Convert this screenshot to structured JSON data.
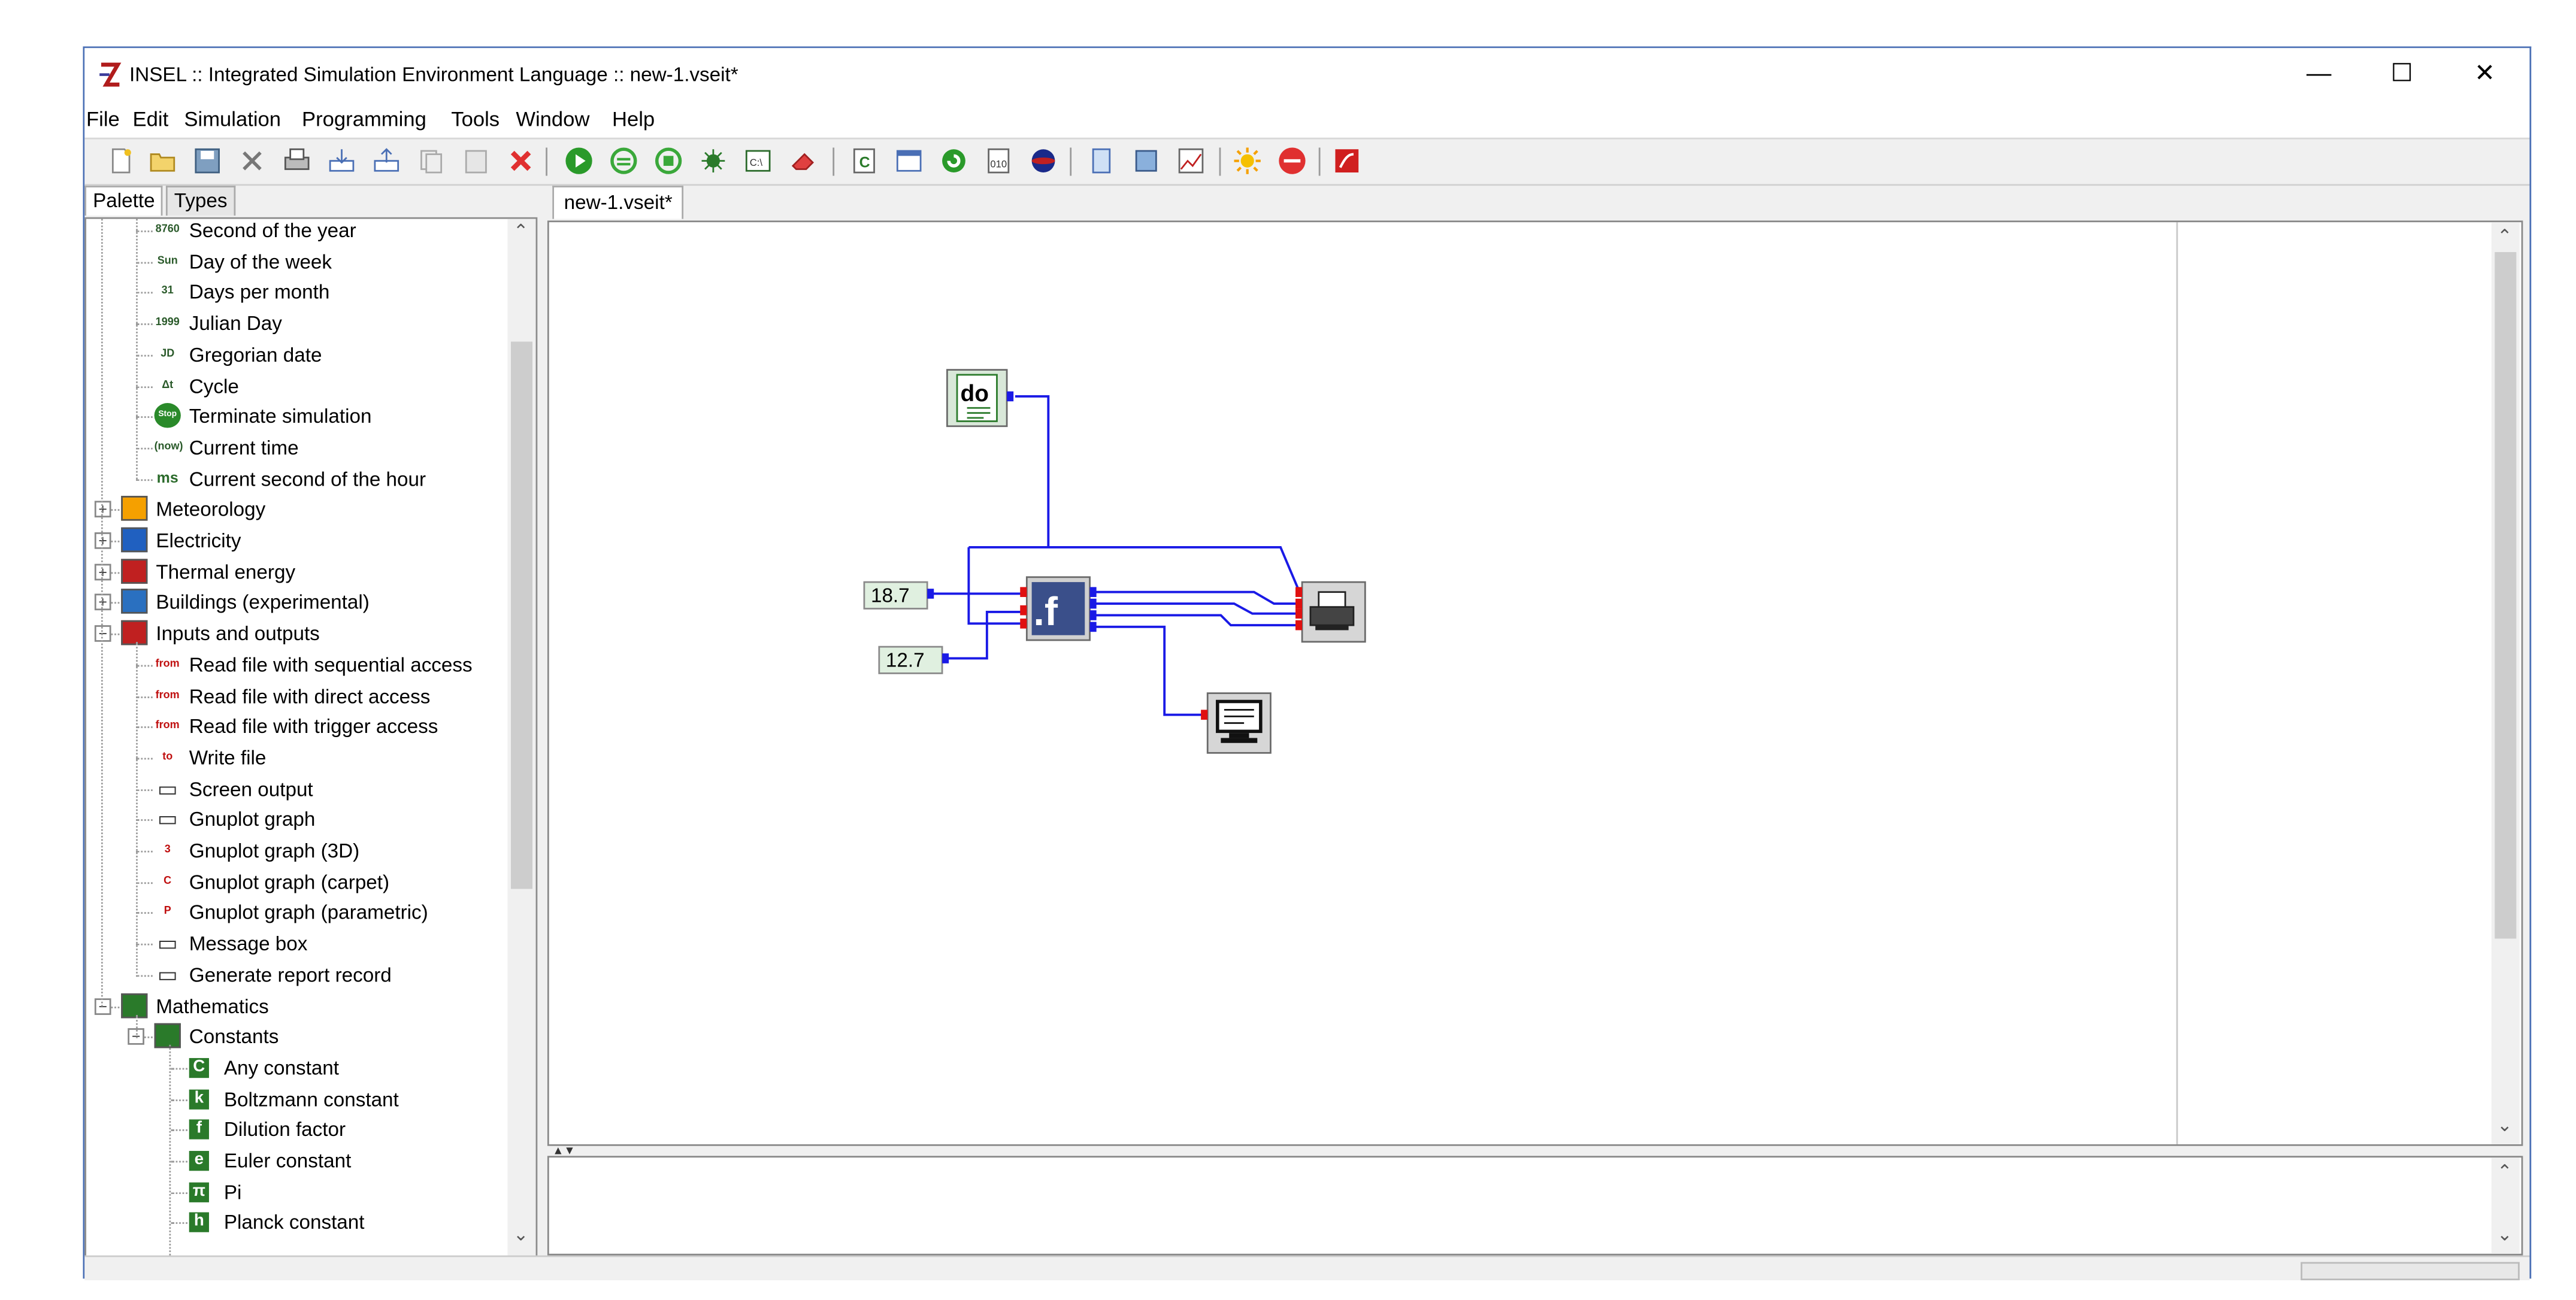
{
  "window": {
    "title": "INSEL :: Integrated Simulation Environment Language :: new-1.vseit*",
    "controls": {
      "minimize": "—",
      "maximize": "☐",
      "close": "✕"
    }
  },
  "menu": [
    "File",
    "Edit",
    "Simulation",
    "Programming",
    "Tools",
    "Window",
    "Help"
  ],
  "left_tabs": [
    "Palette",
    "Types"
  ],
  "tree_items": [
    {
      "label": "Second of the year",
      "icon": "second-of-year-icon",
      "icon_text": "8760"
    },
    {
      "label": "Day of the week",
      "icon": "day-of-week-icon",
      "icon_text": "Sun"
    },
    {
      "label": "Days per month",
      "icon": "days-per-month-icon",
      "icon_text": "31"
    },
    {
      "label": "Julian Day",
      "icon": "julian-day-icon",
      "icon_text": "1999"
    },
    {
      "label": "Gregorian date",
      "icon": "gregorian-date-icon",
      "icon_text": "JD"
    },
    {
      "label": "Cycle",
      "icon": "cycle-icon",
      "icon_text": "Δt"
    },
    {
      "label": "Terminate simulation",
      "icon": "stop-icon",
      "icon_text": "Stop"
    },
    {
      "label": "Current time",
      "icon": "current-time-icon",
      "icon_text": "(now)"
    },
    {
      "label": "Current second of the hour",
      "icon": "ms-icon",
      "icon_text": "ms"
    },
    {
      "label": "Meteorology",
      "icon": "meteorology-icon",
      "icon_text": ""
    },
    {
      "label": "Electricity",
      "icon": "electricity-icon",
      "icon_text": ""
    },
    {
      "label": "Thermal energy",
      "icon": "thermal-energy-icon",
      "icon_text": ""
    },
    {
      "label": "Buildings (experimental)",
      "icon": "buildings-icon",
      "icon_text": ""
    },
    {
      "label": "Inputs and outputs",
      "icon": "inputs-outputs-icon",
      "icon_text": ""
    },
    {
      "label": "Read file with sequential access",
      "icon": "read-file-sequential-icon",
      "icon_text": "from"
    },
    {
      "label": "Read file with direct access",
      "icon": "read-file-direct-icon",
      "icon_text": "from"
    },
    {
      "label": "Read file with trigger access",
      "icon": "read-file-trigger-icon",
      "icon_text": "from"
    },
    {
      "label": "Write file",
      "icon": "write-file-icon",
      "icon_text": "to"
    },
    {
      "label": "Screen output",
      "icon": "screen-output-icon",
      "icon_text": ""
    },
    {
      "label": "Gnuplot graph",
      "icon": "gnuplot-icon",
      "icon_text": ""
    },
    {
      "label": "Gnuplot graph (3D)",
      "icon": "gnuplot-3d-icon",
      "icon_text": "3"
    },
    {
      "label": "Gnuplot graph (carpet)",
      "icon": "gnuplot-carpet-icon",
      "icon_text": "C"
    },
    {
      "label": "Gnuplot graph (parametric)",
      "icon": "gnuplot-parametric-icon",
      "icon_text": "P"
    },
    {
      "label": "Message box",
      "icon": "message-box-icon",
      "icon_text": ""
    },
    {
      "label": "Generate report record",
      "icon": "report-record-icon",
      "icon_text": ""
    },
    {
      "label": "Mathematics",
      "icon": "mathematics-icon",
      "icon_text": ""
    },
    {
      "label": "Constants",
      "icon": "constants-icon",
      "icon_text": ""
    },
    {
      "label": "Any constant",
      "icon": "any-constant-icon",
      "icon_text": "C"
    },
    {
      "label": "Boltzmann constant",
      "icon": "boltzmann-icon",
      "icon_text": "k"
    },
    {
      "label": "Dilution factor",
      "icon": "dilution-icon",
      "icon_text": "f"
    },
    {
      "label": "Euler constant",
      "icon": "euler-icon",
      "icon_text": "e"
    },
    {
      "label": "Pi",
      "icon": "pi-icon",
      "icon_text": "π"
    },
    {
      "label": "Planck constant",
      "icon": "planck-icon",
      "icon_text": "h"
    }
  ],
  "document_tab": "new-1.vseit*",
  "canvas": {
    "do_block": "do",
    "const1": "18.7",
    "const2": "12.7",
    "function_block": ".f"
  },
  "colors": {
    "wire": "#1a1ae6",
    "port_in": "#e01010",
    "port_out": "#1a1ae6",
    "const_bg": "#e0f0e0",
    "window_border": "#4a6fb5"
  }
}
